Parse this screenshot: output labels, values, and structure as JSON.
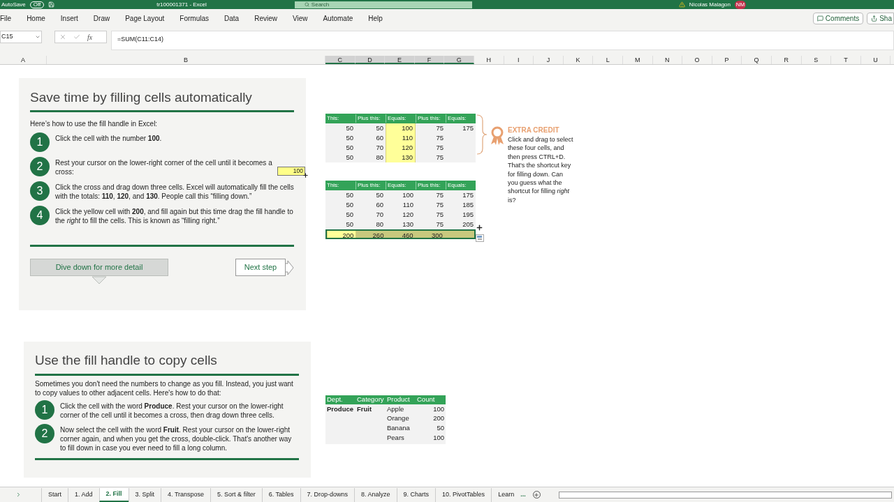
{
  "title_bar": {
    "autosave_label": "AutoSave",
    "autosave_state": "Off",
    "title": "tr100001371 - Excel",
    "search_placeholder": "Search",
    "user_name": "Nicolas Malagon",
    "user_initials": "NM"
  },
  "ribbon_tabs": [
    "File",
    "Home",
    "Insert",
    "Draw",
    "Page Layout",
    "Formulas",
    "Data",
    "Review",
    "View",
    "Automate",
    "Help"
  ],
  "ribbon_buttons": [
    "Comments",
    "Sha"
  ],
  "formula_bar": {
    "name_box": "C15",
    "function_label": "fx",
    "formula": "=SUM(C11:C14)"
  },
  "column_headers": [
    {
      "label": "A",
      "selected": false
    },
    {
      "label": "B",
      "selected": false
    },
    {
      "label": "C",
      "selected": true
    },
    {
      "label": "D",
      "selected": true
    },
    {
      "label": "E",
      "selected": true
    },
    {
      "label": "F",
      "selected": true
    },
    {
      "label": "G",
      "selected": true
    },
    {
      "label": "H",
      "selected": false
    },
    {
      "label": "I",
      "selected": false
    },
    {
      "label": "J",
      "selected": false
    },
    {
      "label": "K",
      "selected": false
    },
    {
      "label": "L",
      "selected": false
    },
    {
      "label": "M",
      "selected": false
    },
    {
      "label": "N",
      "selected": false
    },
    {
      "label": "O",
      "selected": false
    },
    {
      "label": "P",
      "selected": false
    },
    {
      "label": "Q",
      "selected": false
    },
    {
      "label": "R",
      "selected": false
    },
    {
      "label": "S",
      "selected": false
    },
    {
      "label": "T",
      "selected": false
    },
    {
      "label": "U",
      "selected": false
    }
  ],
  "panel_1": {
    "title": "Save time by filling cells automatically",
    "intro": "Here’s how to use the fill handle in Excel:",
    "steps": [
      {
        "number": "1",
        "text": "Click the cell with the number **100**."
      },
      {
        "number": "2",
        "text": "Rest your cursor on the lower-right corner of the cell until it becomes a cross:",
        "sample_cell": "100"
      },
      {
        "number": "3",
        "text": "Click the cross and drag down three cells. Excel will automatically fill the cells with the totals: **110**, **120**, and **130**. People call this “filling down.”"
      },
      {
        "number": "4",
        "text": "Click the yellow cell with **200**, and fill again but this time drag the fill handle to the *right* to fill the cells. This is known as “filling right.”"
      }
    ],
    "dive_button": "Dive down for more detail",
    "next_button": "Next step"
  },
  "table_1": {
    "columns": [
      "This:",
      "Plus this:",
      "Equals:",
      "Plus this:",
      "Equals:"
    ],
    "rows": [
      {
        "selected": false,
        "cells": [
          {
            "value": "50",
            "kind": "plain"
          },
          {
            "value": "50",
            "kind": "plain"
          },
          {
            "value": "100",
            "kind": "yellow"
          },
          {
            "value": "75",
            "kind": "plain"
          },
          {
            "value": "175",
            "kind": "plain"
          }
        ]
      },
      {
        "selected": false,
        "cells": [
          {
            "value": "50",
            "kind": "plain"
          },
          {
            "value": "60",
            "kind": "plain"
          },
          {
            "value": "110",
            "kind": "yellow"
          },
          {
            "value": "75",
            "kind": "plain"
          },
          {
            "kind": "plain"
          }
        ]
      },
      {
        "selected": false,
        "cells": [
          {
            "value": "50",
            "kind": "plain"
          },
          {
            "value": "70",
            "kind": "plain"
          },
          {
            "value": "120",
            "kind": "yellow"
          },
          {
            "value": "75",
            "kind": "plain"
          },
          {
            "kind": "plain"
          }
        ]
      },
      {
        "selected": false,
        "cells": [
          {
            "value": "50",
            "kind": "plain"
          },
          {
            "value": "80",
            "kind": "plain"
          },
          {
            "value": "130",
            "kind": "yellow"
          },
          {
            "value": "75",
            "kind": "plain"
          },
          {
            "kind": "plain"
          }
        ]
      }
    ]
  },
  "extra_credit": {
    "heading": "EXTRA CREDIT",
    "text": "Click and drag to select these four cells, and then press CTRL+D. That's the shortcut key for filling down. Can you guess what the shortcut for filling *right* is?"
  },
  "table_2": {
    "columns": [
      "This:",
      "Plus this:",
      "Equals:",
      "Plus this:",
      "Equals:"
    ],
    "rows": [
      {
        "selected": false,
        "cells": [
          {
            "value": "50",
            "kind": "plain"
          },
          {
            "value": "50",
            "kind": "plain"
          },
          {
            "value": "100",
            "kind": "plain"
          },
          {
            "value": "75",
            "kind": "plain"
          },
          {
            "value": "175",
            "kind": "plain"
          }
        ]
      },
      {
        "selected": false,
        "cells": [
          {
            "value": "50",
            "kind": "plain"
          },
          {
            "value": "60",
            "kind": "plain"
          },
          {
            "value": "110",
            "kind": "plain"
          },
          {
            "value": "75",
            "kind": "plain"
          },
          {
            "value": "185",
            "kind": "plain"
          }
        ]
      },
      {
        "selected": false,
        "cells": [
          {
            "value": "50",
            "kind": "plain"
          },
          {
            "value": "70",
            "kind": "plain"
          },
          {
            "value": "120",
            "kind": "plain"
          },
          {
            "value": "75",
            "kind": "plain"
          },
          {
            "value": "195",
            "kind": "plain"
          }
        ]
      },
      {
        "selected": false,
        "cells": [
          {
            "value": "50",
            "kind": "plain"
          },
          {
            "value": "80",
            "kind": "plain"
          },
          {
            "value": "130",
            "kind": "plain"
          },
          {
            "value": "75",
            "kind": "plain"
          },
          {
            "value": "205",
            "kind": "plain"
          }
        ]
      },
      {
        "selected": true,
        "cells": [
          {
            "value": "200",
            "kind": "yellow"
          },
          {
            "value": "260",
            "kind": "range"
          },
          {
            "value": "460",
            "kind": "range"
          },
          {
            "value": "300",
            "kind": "range"
          },
          {
            "kind": "range"
          }
        ]
      }
    ]
  },
  "panel_2": {
    "title": "Use the fill handle to copy cells",
    "intro": "Sometimes you don't need the numbers to change as you fill. Instead, you just want to copy values to other adjacent cells. Here's how to do that:",
    "steps": [
      {
        "number": "1",
        "text": "Click the cell with the word **Produce**. Rest your cursor on the lower-right corner of the cell until it becomes a cross, then drag down three cells."
      },
      {
        "number": "2",
        "text": "Now select the cell with the word **Fruit**. Rest your cursor on the lower-right corner again, and when you get the cross, double-click. That's another way to fill down in case you ever need to fill a long column."
      }
    ]
  },
  "table_3": {
    "columns": [
      "Dept.",
      "Category",
      "Product",
      "Count"
    ],
    "rows": [
      {
        "dept": "Produce",
        "category": "Fruit",
        "product": "Apple",
        "count": "100"
      },
      {
        "product": "Orange",
        "count": "200"
      },
      {
        "product": "Banana",
        "count": "50"
      },
      {
        "product": "Pears",
        "count": "100"
      }
    ]
  },
  "sheet_tabs": [
    {
      "label": "Start",
      "selected": false
    },
    {
      "label": "1. Add",
      "selected": false
    },
    {
      "label": "2. Fill",
      "selected": true
    },
    {
      "label": "3. Split",
      "selected": false
    },
    {
      "label": "4. Transpose",
      "selected": false
    },
    {
      "label": "5. Sort & filter",
      "selected": false
    },
    {
      "label": "6. Tables",
      "selected": false
    },
    {
      "label": "7. Drop-downs",
      "selected": false
    },
    {
      "label": "8. Analyze",
      "selected": false
    },
    {
      "label": "9. Charts",
      "selected": false
    },
    {
      "label": "10. PivotTables",
      "selected": false
    },
    {
      "label": "Learn",
      "selected": false
    }
  ],
  "sheet_tabs_more": "..."
}
